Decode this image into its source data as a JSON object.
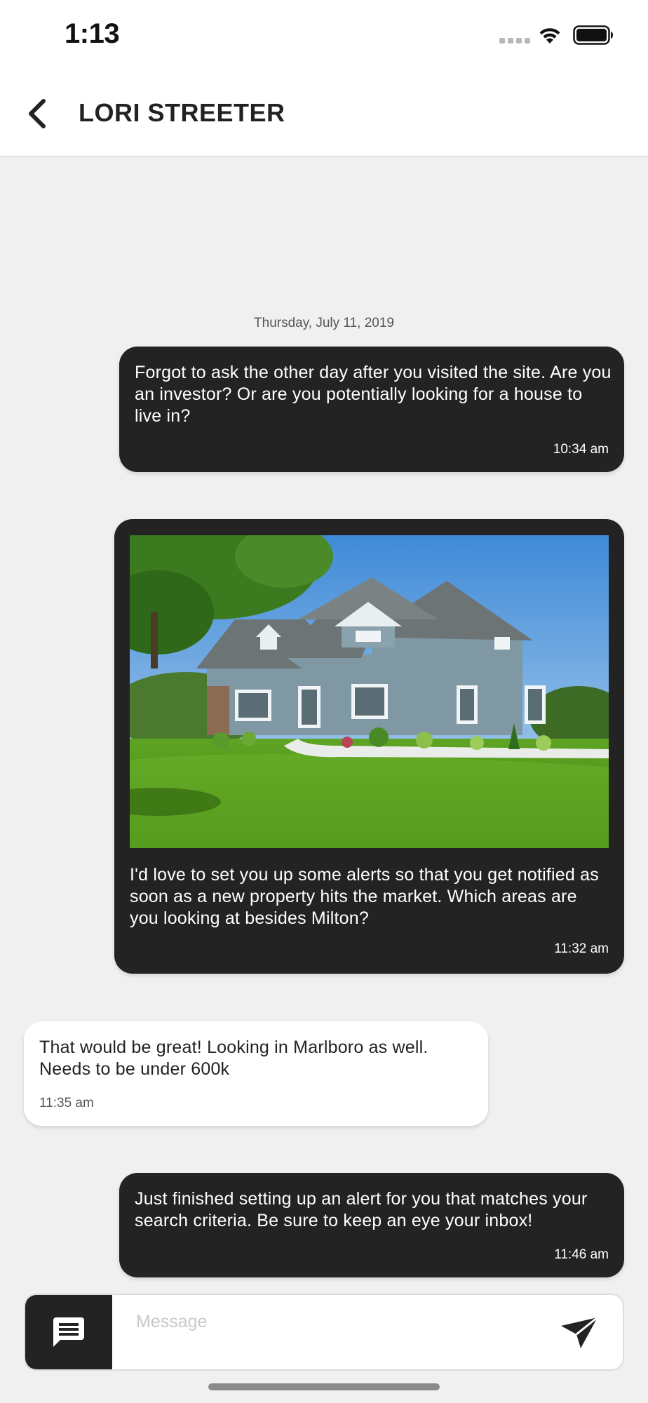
{
  "status_bar": {
    "time": "1:13"
  },
  "header": {
    "title": "LORI STREETER"
  },
  "conversation": {
    "date": "Thursday, July 11, 2019",
    "messages": [
      {
        "direction": "outgoing",
        "text": "Forgot to ask the other day after you visited the site. Are you an investor? Or are you potentially looking for a house to live in?",
        "time": "10:34 am"
      },
      {
        "direction": "outgoing",
        "has_image": true,
        "image": "house-photo",
        "text": "I'd love to set you up some alerts so that you get notified as soon as a new property hits the market. Which areas are you looking at besides Milton?",
        "time": "11:32 am"
      },
      {
        "direction": "incoming",
        "text": "That would be great! Looking in Marlboro as well. Needs to be under  600k",
        "time": "11:35 am"
      },
      {
        "direction": "outgoing",
        "text": "Just finished setting up an alert for you that matches your search criteria. Be sure to keep an eye your inbox!",
        "time": "11:46 am"
      }
    ]
  },
  "composer": {
    "placeholder": "Message",
    "value": ""
  },
  "colors": {
    "outgoing_bubble": "#232323",
    "incoming_bubble": "#ffffff",
    "background": "#f0f0f1"
  },
  "icons": [
    "back-chevron-icon",
    "message-icon",
    "send-icon",
    "wifi-icon",
    "battery-icon",
    "signal-icon"
  ]
}
